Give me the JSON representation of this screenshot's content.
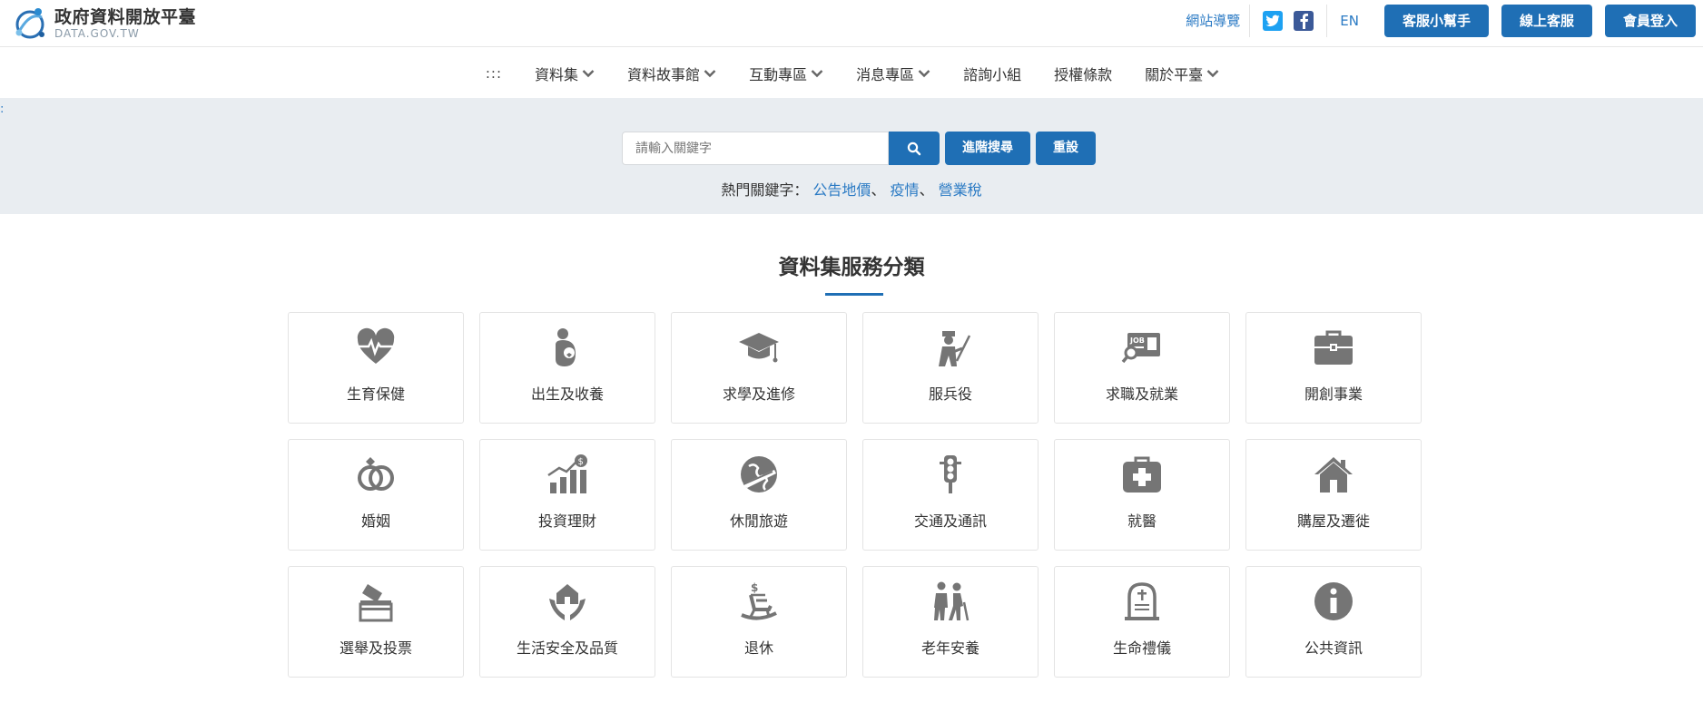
{
  "header": {
    "logo_cn": "政府資料開放平臺",
    "logo_en": "DATA.GOV.TW",
    "sitemap": "網站導覽",
    "lang": "EN",
    "buttons": [
      "客服小幫手",
      "線上客服",
      "會員登入"
    ]
  },
  "nav": {
    "dots": ":::",
    "items": [
      {
        "label": "資料集",
        "dropdown": true
      },
      {
        "label": "資料故事館",
        "dropdown": true
      },
      {
        "label": "互動專區",
        "dropdown": true
      },
      {
        "label": "消息專區",
        "dropdown": true
      },
      {
        "label": "諮詢小組",
        "dropdown": false
      },
      {
        "label": "授權條款",
        "dropdown": false
      },
      {
        "label": "關於平臺",
        "dropdown": true
      }
    ]
  },
  "search": {
    "accessibility_mark": ":",
    "placeholder": "請輸入關鍵字",
    "advanced": "進階搜尋",
    "reset": "重設",
    "hot_label": "熱門關鍵字：",
    "hot_keywords": [
      "公告地價",
      "疫情",
      "營業稅"
    ],
    "separator": "、"
  },
  "section": {
    "title": "資料集服務分類",
    "categories": [
      {
        "label": "生育保健",
        "icon": "heart-pulse-icon"
      },
      {
        "label": "出生及收養",
        "icon": "parent-baby-icon"
      },
      {
        "label": "求學及進修",
        "icon": "graduation-cap-icon"
      },
      {
        "label": "服兵役",
        "icon": "soldier-icon"
      },
      {
        "label": "求職及就業",
        "icon": "job-search-icon"
      },
      {
        "label": "開創事業",
        "icon": "briefcase-icon"
      },
      {
        "label": "婚姻",
        "icon": "rings-icon"
      },
      {
        "label": "投資理財",
        "icon": "growth-chart-icon"
      },
      {
        "label": "休閒旅遊",
        "icon": "globe-plane-icon"
      },
      {
        "label": "交通及通訊",
        "icon": "traffic-light-icon"
      },
      {
        "label": "就醫",
        "icon": "medical-kit-icon"
      },
      {
        "label": "購屋及遷徙",
        "icon": "house-icon"
      },
      {
        "label": "選舉及投票",
        "icon": "ballot-box-icon"
      },
      {
        "label": "生活安全及品質",
        "icon": "hands-house-icon"
      },
      {
        "label": "退休",
        "icon": "rocking-chair-icon"
      },
      {
        "label": "老年安養",
        "icon": "elderly-icon"
      },
      {
        "label": "生命禮儀",
        "icon": "tombstone-icon"
      },
      {
        "label": "公共資訊",
        "icon": "info-icon"
      }
    ]
  },
  "colors": {
    "brand_blue": "#1f6fb5",
    "link_blue": "#2a7ac4",
    "icon_gray": "#757575",
    "band_bg": "#e9edf1",
    "twitter_blue": "#1da1f2",
    "facebook_blue": "#3b5998"
  }
}
